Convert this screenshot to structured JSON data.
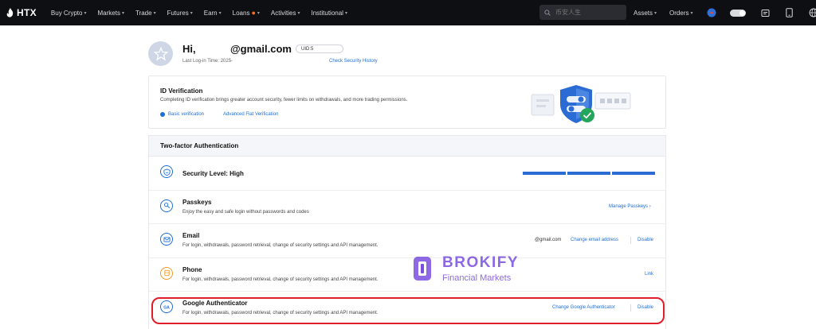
{
  "nav": {
    "logo_text": "HTX",
    "items": [
      {
        "label": "Buy Crypto",
        "caret": true
      },
      {
        "label": "Markets",
        "caret": true
      },
      {
        "label": "Trade",
        "caret": true
      },
      {
        "label": "Futures",
        "caret": true
      },
      {
        "label": "Earn",
        "caret": true
      },
      {
        "label": "Loans",
        "caret": true,
        "fire": true
      },
      {
        "label": "Activities",
        "caret": true
      },
      {
        "label": "Institutional",
        "caret": true
      }
    ],
    "search_placeholder": "币安人生",
    "assets_label": "Assets",
    "orders_label": "Orders",
    "icons": [
      "search-icon",
      "avatar-icon",
      "theme-toggle",
      "notification-icon",
      "download-icon",
      "language-icon"
    ]
  },
  "profile": {
    "greeting": "Hi,",
    "email": "@gmail.com",
    "uid": "UID:5",
    "last_login": "Last Log-in Time: 2025-",
    "history_link": "Check Security History"
  },
  "id_verification": {
    "title": "ID Verification",
    "description": "Completing ID verification brings greater account security, fewer limits on withdrawals, and more trading permissions.",
    "basic_label": "Basic verification",
    "advanced_label": "Advanced Fiat Verification"
  },
  "tfa": {
    "header": "Two-factor Authentication",
    "security_level": "Security Level: High",
    "security_level_filled": 3,
    "security_level_max": 3,
    "rows": {
      "passkeys": {
        "name": "Passkeys",
        "desc": "Enjoy the easy and safe login without passwords and codes",
        "action": "Manage Passkeys ›"
      },
      "email": {
        "name": "Email",
        "desc": "For login, withdrawals, password retrieval, change of security settings and API management.",
        "value": "@gmail.com",
        "action": "Change email address",
        "disable": "Disable"
      },
      "phone": {
        "name": "Phone",
        "desc": "For login, withdrawals, password retrieval, change of security settings and API management.",
        "action": "Link"
      },
      "google": {
        "name": "Google Authenticator",
        "desc": "For login, withdrawals, password retrieval, change of security settings and API management.",
        "action": "Change Google Authenticator",
        "disable": "Disable"
      }
    }
  },
  "watermark": {
    "title": "BROKIFY",
    "subtitle": "Financial Markets"
  },
  "colors": {
    "accent": "#1e6fd9",
    "nav_bg": "#0e0f12",
    "highlight": "#e11d2a",
    "watermark": "#7a4ee0"
  }
}
